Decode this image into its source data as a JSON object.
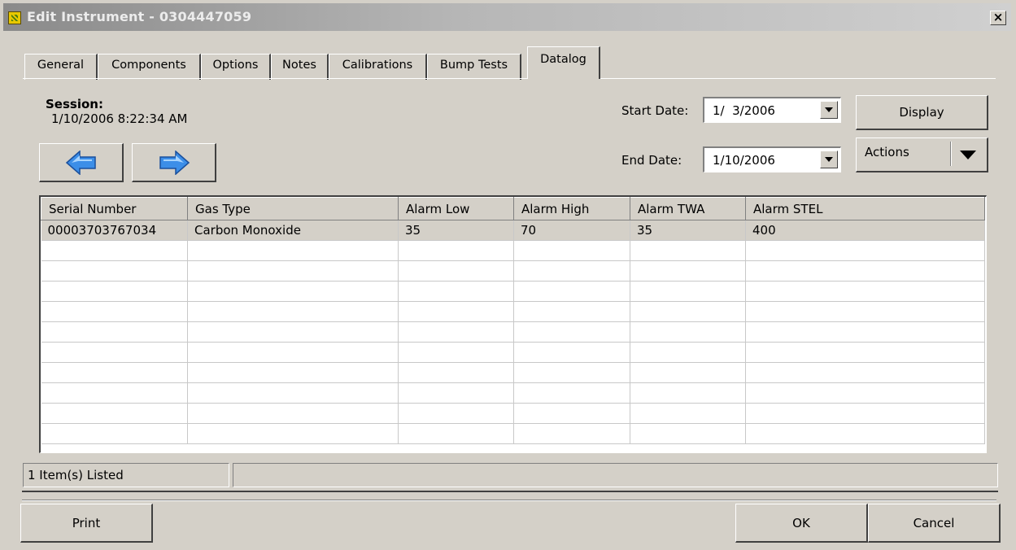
{
  "window": {
    "title": "Edit Instrument - 0304447059",
    "close_label": "×",
    "app_icon": "instrument-app-icon"
  },
  "tabs": [
    {
      "label": "General"
    },
    {
      "label": "Components"
    },
    {
      "label": "Options"
    },
    {
      "label": "Notes"
    },
    {
      "label": "Calibrations"
    },
    {
      "label": "Bump Tests"
    },
    {
      "label": "Datalog",
      "active": true
    }
  ],
  "session": {
    "label": "Session:",
    "value": "1/10/2006 8:22:34 AM"
  },
  "nav": {
    "prev_icon": "left-arrow-icon",
    "next_icon": "right-arrow-icon",
    "arrow_color": "#3c8ee8"
  },
  "filters": {
    "start_label": "Start Date:",
    "start_value": "1/  3/2006",
    "end_label": "End Date:",
    "end_value": "1/10/2006"
  },
  "buttons": {
    "display": "Display",
    "actions": "Actions",
    "print": "Print",
    "ok": "OK",
    "cancel": "Cancel"
  },
  "grid": {
    "columns": [
      "Serial Number",
      "Gas Type",
      "Alarm Low",
      "Alarm High",
      "Alarm TWA",
      "Alarm STEL"
    ],
    "rows": [
      [
        "00003703767034",
        "Carbon Monoxide",
        "35",
        "70",
        "35",
        "400"
      ]
    ]
  },
  "status": {
    "items_listed": "1 Item(s) Listed",
    "secondary": ""
  }
}
